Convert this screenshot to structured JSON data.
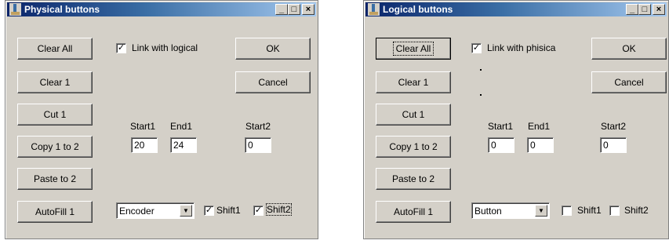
{
  "windows": [
    {
      "title": "Physical buttons",
      "controls": {
        "minimize": "_",
        "maximize": "□",
        "close": "×"
      },
      "buttons": [
        "Clear All",
        "Clear 1",
        "Cut 1",
        "Copy 1 to 2",
        "Paste to 2",
        "AutoFill 1"
      ],
      "link_label": "Link with logical",
      "link_checked": "✓",
      "ok": "OK",
      "cancel": "Cancel",
      "start1_label": "Start1",
      "end1_label": "End1",
      "start2_label": "Start2",
      "start1": "20",
      "end1": "24",
      "start2": "0",
      "combo": "Encoder",
      "shift1_label": "Shift1",
      "shift1_check": "✓",
      "shift2_label": "Shift2",
      "shift2_check": "✓"
    },
    {
      "title": "Logical buttons",
      "controls": {
        "minimize": "_",
        "maximize": "□",
        "close": "×"
      },
      "buttons": [
        "Clear All",
        "Clear 1",
        "Cut 1",
        "Copy 1 to 2",
        "Paste to 2",
        "AutoFill 1"
      ],
      "link_label": "Link with phisica",
      "link_checked": "✓",
      "ok": "OK",
      "cancel": "Cancel",
      "start1_label": "Start1",
      "end1_label": "End1",
      "start2_label": "Start2",
      "start1": "0",
      "end1": "0",
      "start2": "0",
      "combo": "Button",
      "shift1_label": "Shift1",
      "shift1_check": "",
      "shift2_label": "Shift2",
      "shift2_check": ""
    }
  ]
}
